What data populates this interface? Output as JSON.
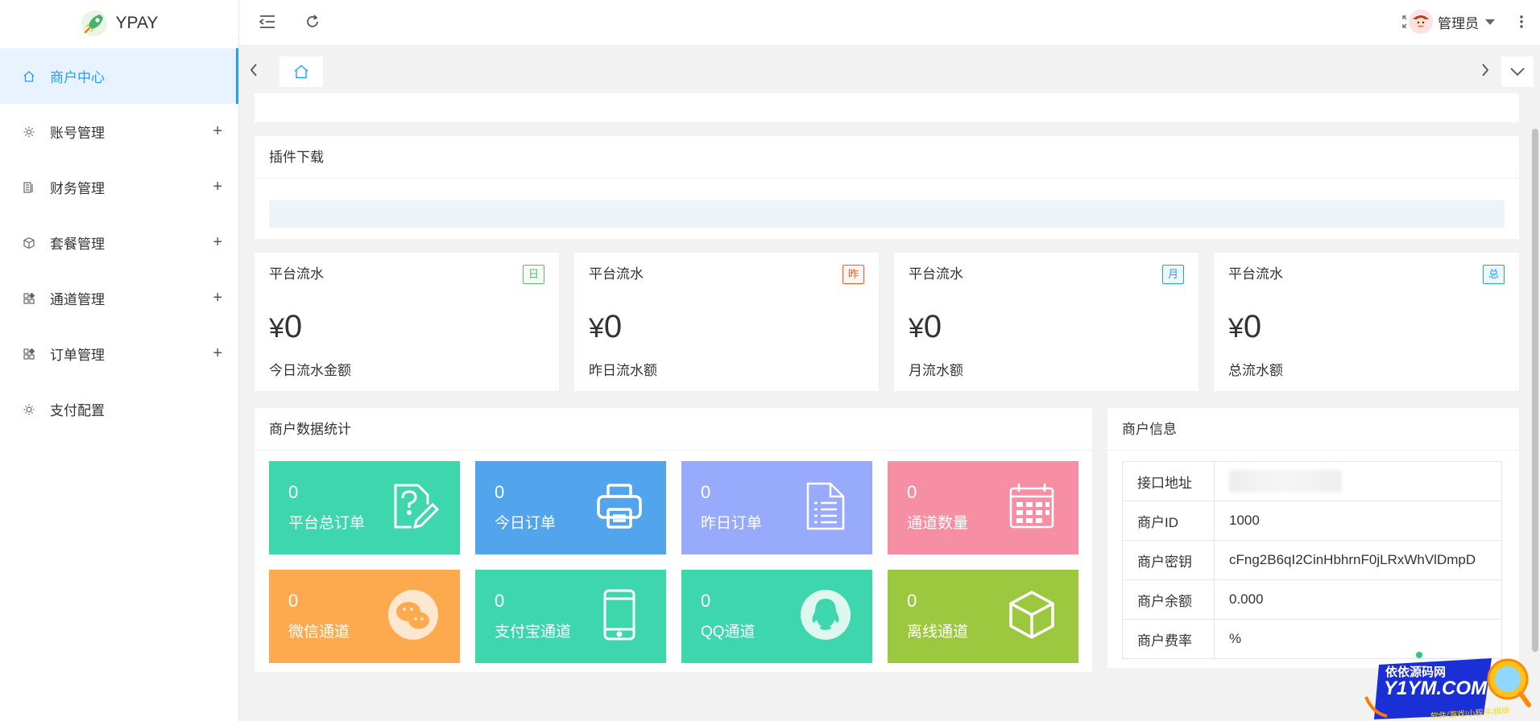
{
  "app": {
    "name": "YPAY"
  },
  "sidebar": {
    "items": [
      {
        "label": "商户中心",
        "icon": "home-icon",
        "active": true,
        "expandable": false
      },
      {
        "label": "账号管理",
        "icon": "gear-icon",
        "expandable": true
      },
      {
        "label": "财务管理",
        "icon": "finance-icon",
        "expandable": true
      },
      {
        "label": "套餐管理",
        "icon": "box-icon",
        "expandable": true
      },
      {
        "label": "通道管理",
        "icon": "grid-icon",
        "expandable": true
      },
      {
        "label": "订单管理",
        "icon": "grid-icon",
        "expandable": true
      },
      {
        "label": "支付配置",
        "icon": "settings-icon",
        "expandable": false
      }
    ],
    "expand_symbol": "+"
  },
  "header": {
    "user_name": "管理员"
  },
  "plugin": {
    "title": "插件下载"
  },
  "stats": [
    {
      "title": "平台流水",
      "badge": "日",
      "badge_color": "#5fb878",
      "currency": "¥",
      "value": "0",
      "label": "今日流水金额"
    },
    {
      "title": "平台流水",
      "badge": "昨",
      "badge_color": "#ff5722",
      "currency": "¥",
      "value": "0",
      "label": "昨日流水额"
    },
    {
      "title": "平台流水",
      "badge": "月",
      "badge_color": "#1e9fff",
      "currency": "¥",
      "value": "0",
      "label": "月流水额"
    },
    {
      "title": "平台流水",
      "badge": "总",
      "badge_color": "#1e9fff",
      "currency": "¥",
      "value": "0",
      "label": "总流水额"
    }
  ],
  "merchant_stats": {
    "title": "商户数据统计",
    "tiles": [
      {
        "value": "0",
        "label": "平台总订单",
        "color": "#3ed6ad",
        "icon": "edit-document-icon"
      },
      {
        "value": "0",
        "label": "今日订单",
        "color": "#52a5ec",
        "icon": "printer-icon"
      },
      {
        "value": "0",
        "label": "昨日订单",
        "color": "#98aafb",
        "icon": "document-list-icon"
      },
      {
        "value": "0",
        "label": "通道数量",
        "color": "#f68fa3",
        "icon": "calendar-icon"
      },
      {
        "value": "0",
        "label": "微信通道",
        "color": "#fdaa4f",
        "icon": "wechat-icon"
      },
      {
        "value": "0",
        "label": "支付宝通道",
        "color": "#3ed6ad",
        "icon": "mobile-icon"
      },
      {
        "value": "0",
        "label": "QQ通道",
        "color": "#3ed6ad",
        "icon": "qq-icon"
      },
      {
        "value": "0",
        "label": "离线通道",
        "color": "#9bc83e",
        "icon": "cube-icon"
      }
    ]
  },
  "merchant_info": {
    "title": "商户信息",
    "rows": [
      {
        "key": "接口地址",
        "value": ""
      },
      {
        "key": "商户ID",
        "value": "1000"
      },
      {
        "key": "商户密钥",
        "value": "cFng2B6qI2CinHbhrnF0jLRxWhVlDmpD"
      },
      {
        "key": "商户余额",
        "value": "0.000"
      },
      {
        "key": "商户费率",
        "value": "%"
      }
    ]
  },
  "watermark": {
    "line1": "依依源码网",
    "line2": "Y1YM.COM",
    "line3": "软件/游戏/小程序/棋牌"
  }
}
